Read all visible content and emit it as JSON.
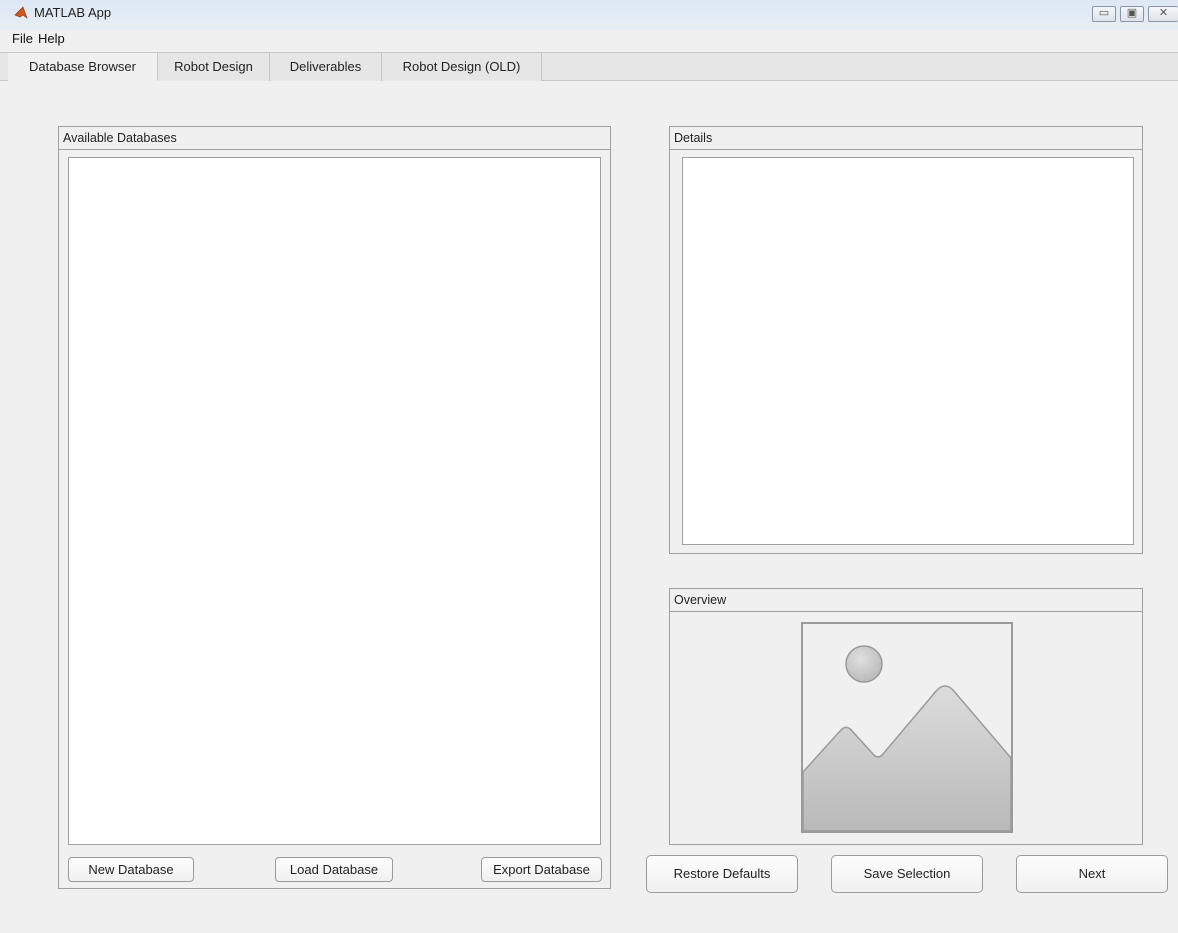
{
  "window": {
    "title": "MATLAB App"
  },
  "menu": {
    "file": "File",
    "help": "Help"
  },
  "tabs": [
    {
      "label": "Database Browser",
      "active": true
    },
    {
      "label": "Robot Design",
      "active": false
    },
    {
      "label": "Deliverables",
      "active": false
    },
    {
      "label": "Robot Design (OLD)",
      "active": false
    }
  ],
  "databases_panel": {
    "title": "Available Databases",
    "buttons": {
      "new": "New Database",
      "load": "Load Database",
      "export": "Export Database"
    }
  },
  "details_panel": {
    "title": "Details"
  },
  "overview_panel": {
    "title": "Overview",
    "image_icon": "image-placeholder-icon"
  },
  "actions": {
    "restore": "Restore Defaults",
    "save": "Save Selection",
    "next": "Next"
  },
  "colors": {
    "background": "#f0f0f0",
    "border": "#a0a0a0",
    "list_bg": "#ffffff"
  }
}
